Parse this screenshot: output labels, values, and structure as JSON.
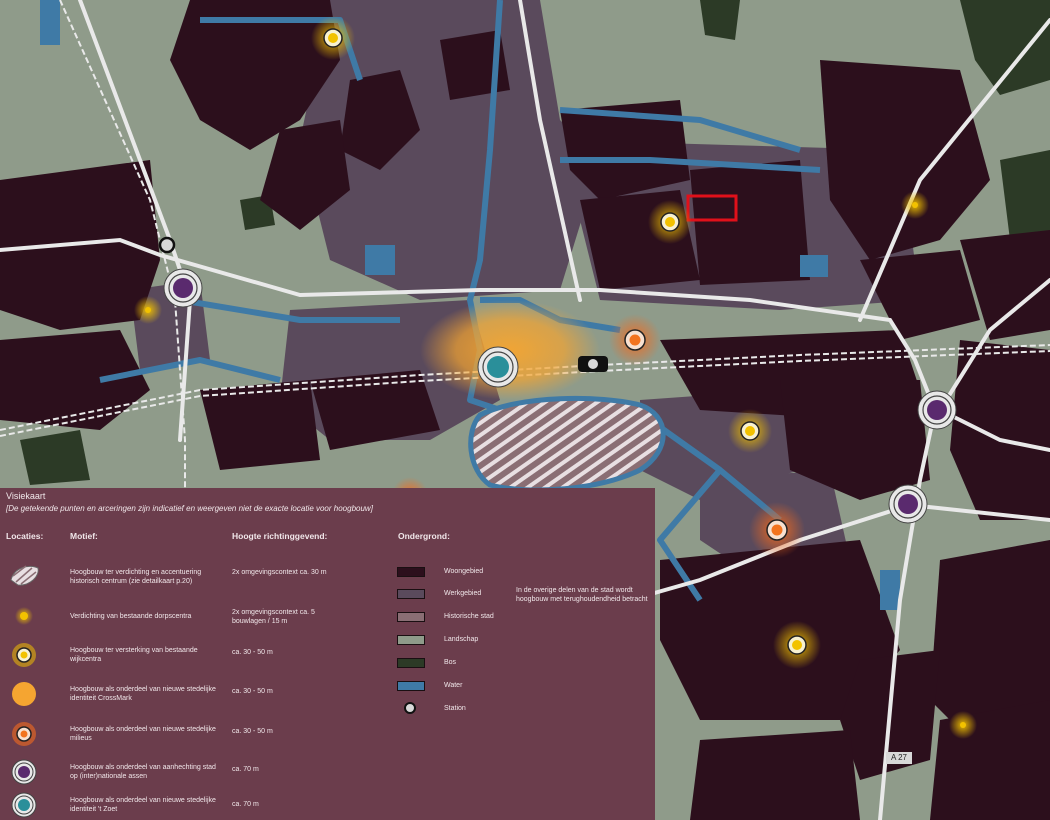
{
  "map": {
    "road_label": "A 27",
    "colors": {
      "woongebied": "#2c0f1c",
      "werkgebied": "#5a4a5c",
      "historisch": "#8a6e74",
      "landschap": "#8f9b8a",
      "bos": "#2c3a26",
      "water": "#3f7aa6",
      "road": "#e9e9e9",
      "highlight": "#e0101a",
      "yellow": "#f2c200",
      "orange": "#f28a1e",
      "purple": "#5a2a6e",
      "teal": "#2a8f9a",
      "crossmark": "#f5a531"
    }
  },
  "legend": {
    "title": "Visiekaart",
    "subtitle": "[De getekende punten en arceringen zijn indicatief en weergeven niet de exacte locatie voor hoogbouw]",
    "headers": {
      "locaties": "Locaties:",
      "motief": "Motief:",
      "hoogte": "Hoogte richtinggevend:",
      "ondergrond": "Ondergrond:"
    },
    "rows": [
      {
        "icon": "historic-hatch-icon",
        "motief": "Hoogbouw ter verdichting en accentuering historisch centrum (zie detailkaart p.20)",
        "hoogte": "2x omgevingscontext ca. 30 m"
      },
      {
        "icon": "small-yellow-dot-icon",
        "motief": "Verdichting van bestaande dorpscentra",
        "hoogte": "2x omgevingscontext ca. 5 bouwlagen / 15 m"
      },
      {
        "icon": "yellow-ring-dot-icon",
        "motief": "Hoogbouw ter versterking van bestaande wijkcentra",
        "hoogte": "ca. 30 - 50 m"
      },
      {
        "icon": "orange-glow-icon",
        "motief": "Hoogbouw als onderdeel van nieuwe stedelijke identiteit CrossMark",
        "hoogte": "ca. 30 - 50 m"
      },
      {
        "icon": "orange-ring-dot-icon",
        "motief": "Hoogbouw als onderdeel van nieuwe stedelijke milieus",
        "hoogte": "ca. 30 - 50 m"
      },
      {
        "icon": "purple-ring-dot-icon",
        "motief": "Hoogbouw als onderdeel van aanhechting stad op (inter)nationale assen",
        "hoogte": "ca. 70 m"
      },
      {
        "icon": "teal-ring-dot-icon",
        "motief": "Hoogbouw als onderdeel van nieuwe stedelijke identiteit 't Zoet",
        "hoogte": "ca. 70 m"
      }
    ],
    "ondergrond": [
      {
        "label": "Woongebied",
        "color": "#2c0f1c"
      },
      {
        "label": "Werkgebied",
        "color": "#5a4a5c"
      },
      {
        "label": "Historische stad",
        "color": "#8a6e74"
      },
      {
        "label": "Landschap",
        "color": "#8f9b8a"
      },
      {
        "label": "Bos",
        "color": "#2c3a26"
      },
      {
        "label": "Water",
        "color": "#3f7aa6"
      },
      {
        "label": "Station",
        "color": "#d9d9d9"
      }
    ],
    "note": "In de overige delen van de stad wordt hoogbouw met terughoudendheid betracht"
  }
}
